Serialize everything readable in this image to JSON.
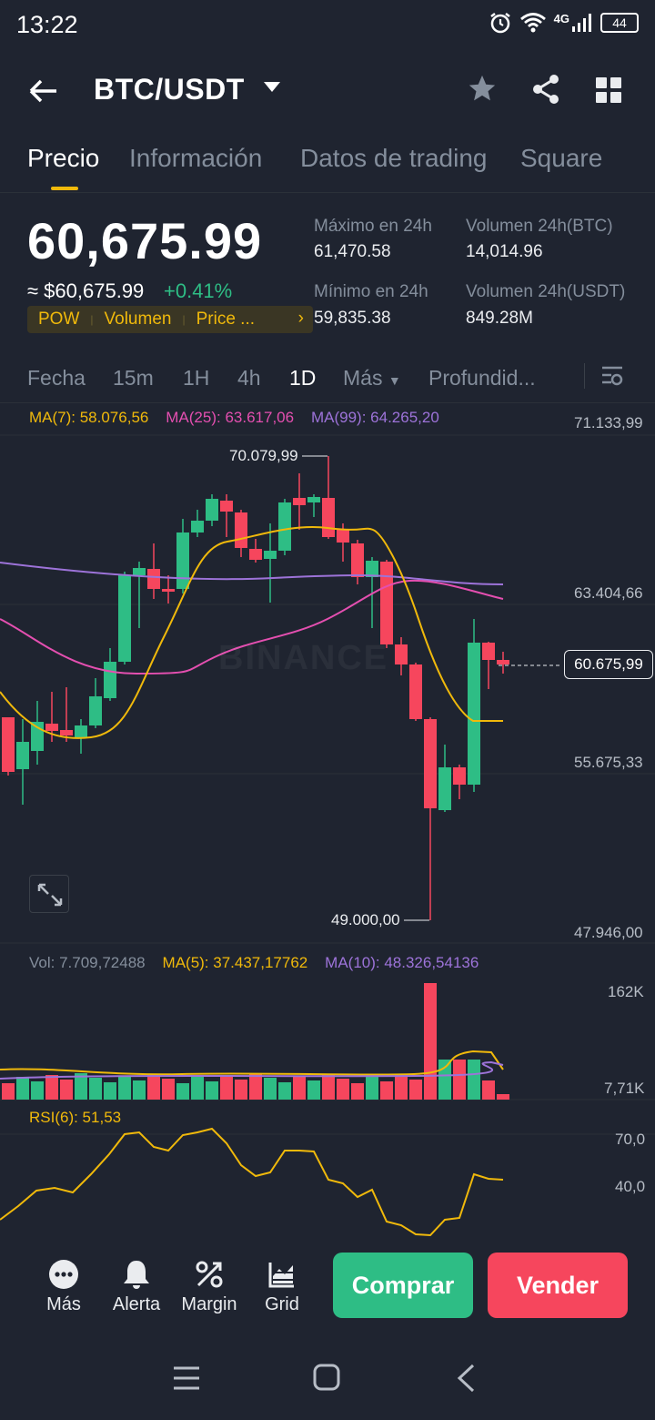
{
  "status_bar": {
    "time": "13:22",
    "network": "4G",
    "battery": "44"
  },
  "header": {
    "pair": "BTC/USDT"
  },
  "tabs": [
    {
      "label": "Precio",
      "active": true
    },
    {
      "label": "Información",
      "active": false
    },
    {
      "label": "Datos de trading",
      "active": false
    },
    {
      "label": "Square",
      "active": false
    }
  ],
  "price": {
    "last": "60,675.99",
    "usd": "≈ $60,675.99",
    "change_pct": "+0.41%",
    "tags": [
      "POW",
      "Volumen",
      "Price ..."
    ]
  },
  "stats": {
    "high_label": "Máximo en 24h",
    "high_value": "61,470.58",
    "low_label": "Mínimo en 24h",
    "low_value": "59,835.38",
    "vol_btc_label": "Volumen 24h(BTC)",
    "vol_btc_value": "14,014.96",
    "vol_usdt_label": "Volumen 24h(USDT)",
    "vol_usdt_value": "849.28M"
  },
  "intervals": {
    "items": [
      "Fecha",
      "15m",
      "1H",
      "4h",
      "1D",
      "Más",
      "Profundid..."
    ],
    "active": "1D"
  },
  "chart": {
    "ma7": "MA(7): 58.076,56",
    "ma25": "MA(25): 63.617,06",
    "ma99": "MA(99): 64.265,20",
    "axis": [
      "71.133,99",
      "63.404,66",
      "55.675,33",
      "47.946,00"
    ],
    "current_price": "60.675,99",
    "high_mark": "70.079,99",
    "low_mark": "49.000,00",
    "watermark": "BINANCE",
    "colors": {
      "up": "#2ebd85",
      "down": "#f6465d",
      "ma7": "#f0b90b",
      "ma25": "#e44fb0",
      "ma99": "#9d73d9"
    }
  },
  "volume": {
    "vol": "Vol: 7.709,72488",
    "ma5": "MA(5): 37.437,17762",
    "ma10": "MA(10): 48.326,54136",
    "axis_top": "162K",
    "axis_bottom": "7,71K"
  },
  "rsi": {
    "label": "RSI(6): 51,53",
    "axis_top": "70,0",
    "axis_bottom": "40,0"
  },
  "actions": {
    "more": "Más",
    "alert": "Alerta",
    "margin": "Margin",
    "grid": "Grid",
    "buy": "Comprar",
    "sell": "Vender"
  }
}
